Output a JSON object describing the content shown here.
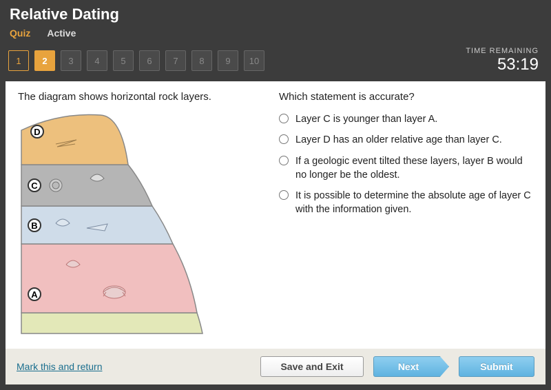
{
  "header": {
    "title": "Relative Dating",
    "quiz_label": "Quiz",
    "active_label": "Active"
  },
  "nav": {
    "items": [
      {
        "n": "1",
        "state": "done"
      },
      {
        "n": "2",
        "state": "current"
      },
      {
        "n": "3",
        "state": ""
      },
      {
        "n": "4",
        "state": ""
      },
      {
        "n": "5",
        "state": ""
      },
      {
        "n": "6",
        "state": ""
      },
      {
        "n": "7",
        "state": ""
      },
      {
        "n": "8",
        "state": ""
      },
      {
        "n": "9",
        "state": ""
      },
      {
        "n": "10",
        "state": ""
      }
    ]
  },
  "timer": {
    "label": "TIME REMAINING",
    "value": "53:19"
  },
  "question": {
    "left_prompt": "The diagram shows horizontal rock layers.",
    "right_prompt": "Which statement is accurate?",
    "layers": {
      "d": "D",
      "c": "C",
      "b": "B",
      "a": "A"
    },
    "options": [
      "Layer C is younger than layer A.",
      "Layer D has an older relative age than layer C.",
      "If a geologic event tilted these layers, layer B would no longer be the oldest.",
      "It is possible to determine the absolute age of layer C with the information given."
    ]
  },
  "footer": {
    "mark": "Mark this and return",
    "save": "Save and Exit",
    "next": "Next",
    "submit": "Submit"
  }
}
